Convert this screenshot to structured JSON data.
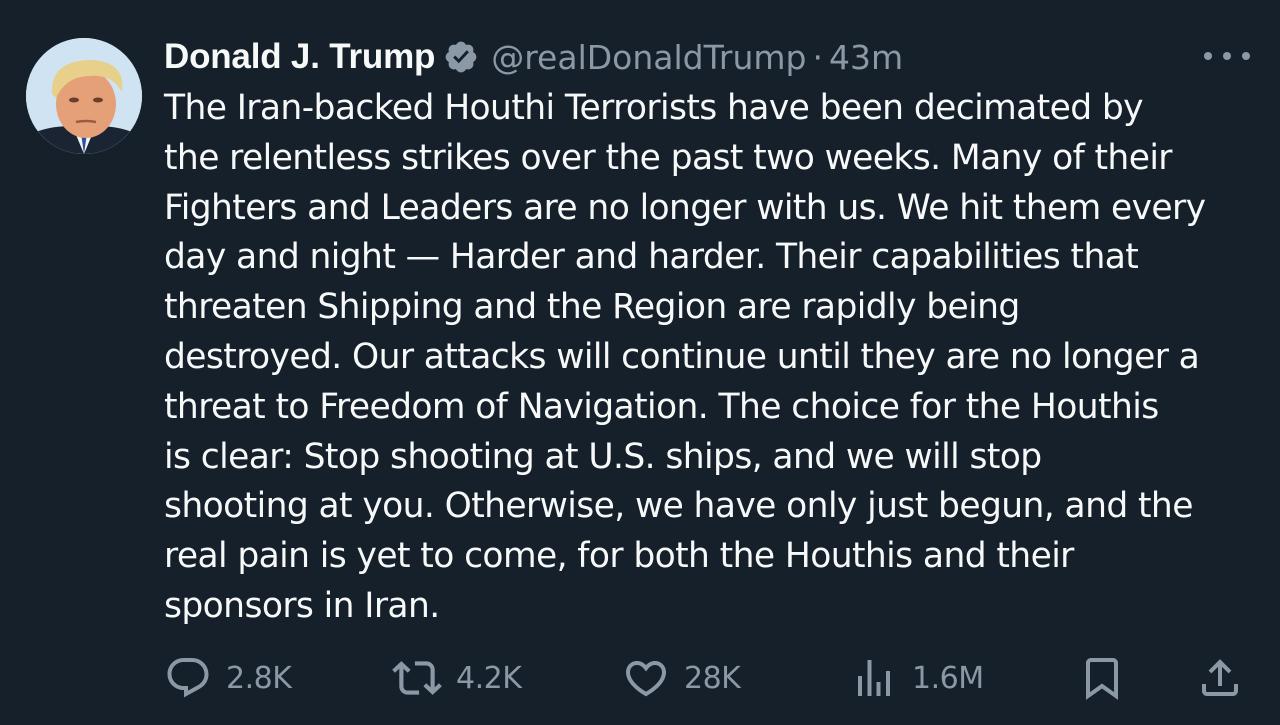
{
  "tweet": {
    "author": {
      "display_name": "Donald J. Trump",
      "handle": "@realDonaldTrump",
      "verified": true
    },
    "separator": "·",
    "time_ago": "43m",
    "text_lines": [
      "The Iran-backed Houthi Terrorists have been decimated by",
      "the relentless strikes over the past two weeks. Many of their",
      "Fighters and Leaders are no longer with us. We hit them every",
      "day and night — Harder and harder. Their capabilities that",
      "threaten Shipping and the Region are rapidly being",
      "destroyed. Our attacks will continue until they are no longer a",
      "threat to Freedom of Navigation. The choice for the Houthis",
      "is clear: Stop shooting at U.S. ships, and we will stop",
      "shooting at you. Otherwise, we have only just begun, and the",
      "real pain is yet to come, for both the Houthis and their",
      "sponsors in Iran."
    ],
    "metrics": {
      "replies": "2.8K",
      "reposts": "4.2K",
      "likes": "28K",
      "views": "1.6M"
    }
  },
  "icons": {
    "verified": "verified-badge-icon",
    "more": "more-dots-icon",
    "reply": "reply-bubble-icon",
    "repost": "repost-arrows-icon",
    "like": "heart-icon",
    "views": "bar-chart-icon",
    "bookmark": "bookmark-icon",
    "share": "share-upload-icon"
  },
  "colors": {
    "background": "#15202b",
    "text_primary": "#f7f9f9",
    "text_secondary": "#8b98a5",
    "verified_badge": "#8b98a5"
  }
}
